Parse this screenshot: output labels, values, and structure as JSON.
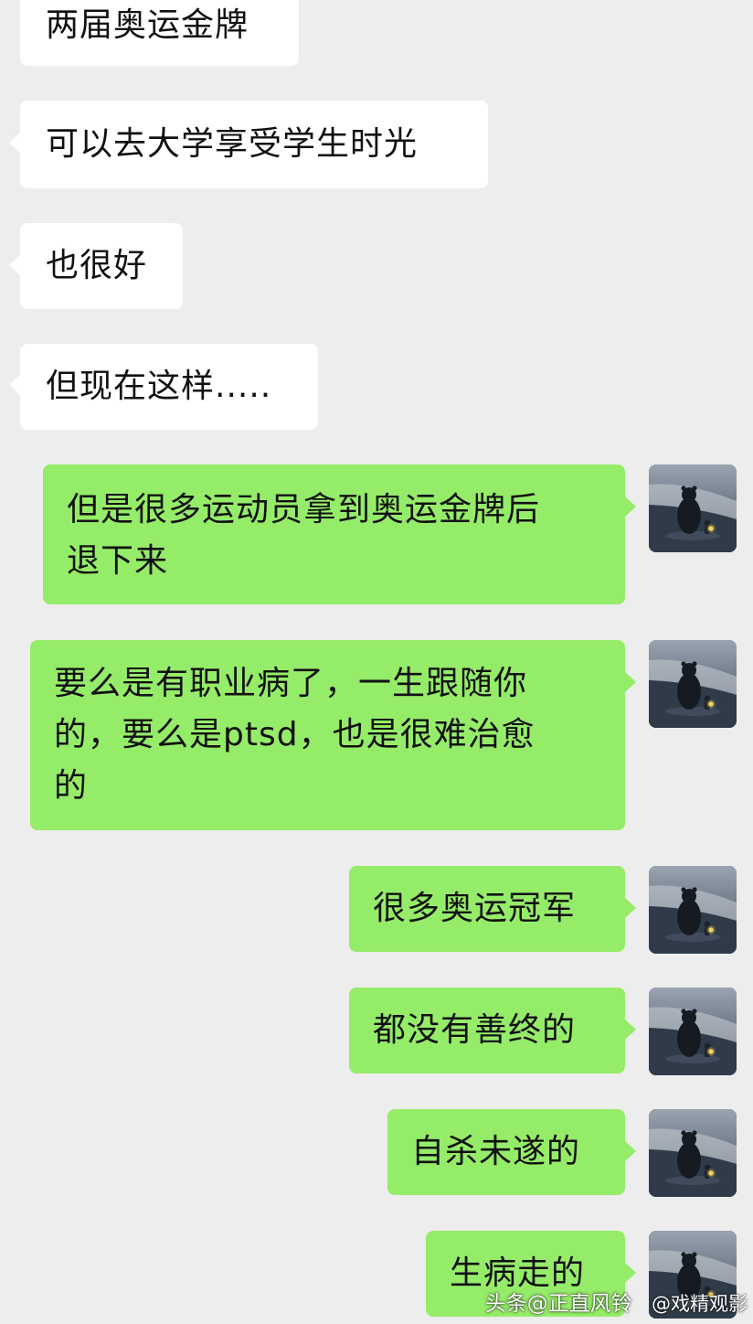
{
  "conversation": {
    "incoming": [
      {
        "text": "两届奥运金牌"
      },
      {
        "text": "可以去大学享受学生时光"
      },
      {
        "text": "也很好"
      },
      {
        "text": "但现在这样....."
      }
    ],
    "outgoing": [
      {
        "lines": [
          "但是很多运动员拿到奥运金牌后",
          "退下来"
        ]
      },
      {
        "lines": [
          "要么是有职业病了，一生跟随你",
          "的，要么是ptsd，也是很难治愈",
          "的"
        ]
      },
      {
        "lines": [
          "很多奥运冠军"
        ]
      },
      {
        "lines": [
          "都没有善终的"
        ]
      },
      {
        "lines": [
          "自杀未遂的"
        ]
      },
      {
        "lines": [
          "生病走的"
        ]
      }
    ]
  },
  "colors": {
    "background": "#ededed",
    "incoming_bubble": "#ffffff",
    "outgoing_bubble": "#95ec69",
    "text": "#111111"
  },
  "watermark": {
    "source": "头条@正直风铃",
    "weibo": "@戏精观影"
  }
}
